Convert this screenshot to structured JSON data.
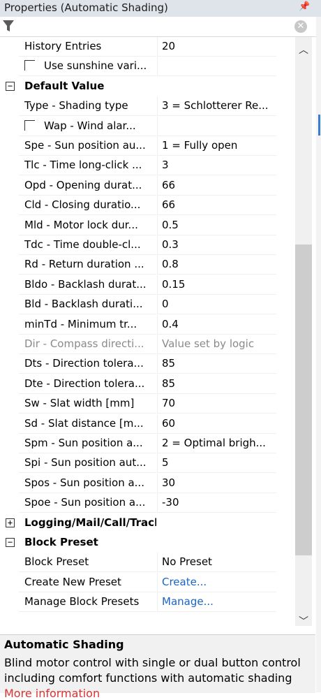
{
  "panel": {
    "title": "Properties (Automatic Shading)",
    "pin_icon": "pin-icon",
    "filter_icon": "filter-icon",
    "clear_icon": "clear-filter-icon",
    "clear_glyph": "✕"
  },
  "rows": [
    {
      "kind": "prop",
      "name": "History Entries",
      "value": "20"
    },
    {
      "kind": "check",
      "name": "Use sunshine vari...",
      "value": ""
    },
    {
      "kind": "cat",
      "name": "Default Value",
      "expander": "⊟",
      "expanded": true
    },
    {
      "kind": "prop",
      "name": "Type - Shading type",
      "value": "3 = Schlotterer Re..."
    },
    {
      "kind": "check",
      "name": "Wap - Wind alar...",
      "value": ""
    },
    {
      "kind": "prop",
      "name": "Spe - Sun position au...",
      "value": "1 = Fully open"
    },
    {
      "kind": "prop",
      "name": "Tlc - Time long-click ...",
      "value": "3"
    },
    {
      "kind": "prop",
      "name": "Opd - Opening durat...",
      "value": "66"
    },
    {
      "kind": "prop",
      "name": "Cld - Closing duratio...",
      "value": "66"
    },
    {
      "kind": "prop",
      "name": "Mld - Motor lock dur...",
      "value": "0.5"
    },
    {
      "kind": "prop",
      "name": "Tdc - Time double-cl...",
      "value": "0.3"
    },
    {
      "kind": "prop",
      "name": "Rd - Return duration ...",
      "value": "0.8"
    },
    {
      "kind": "prop",
      "name": "Bldo - Backlash durat...",
      "value": "0.15"
    },
    {
      "kind": "prop",
      "name": "Bld - Backlash durati...",
      "value": "0"
    },
    {
      "kind": "prop",
      "name": "minTd - Minimum tr...",
      "value": "0.4"
    },
    {
      "kind": "disabled",
      "name": "Dir - Compass directi...",
      "value": "Value set by logic"
    },
    {
      "kind": "prop",
      "name": "Dts - Direction tolera...",
      "value": "85"
    },
    {
      "kind": "prop",
      "name": "Dte - Direction tolera...",
      "value": "85"
    },
    {
      "kind": "prop",
      "name": "Sw - Slat width [mm]",
      "value": "70"
    },
    {
      "kind": "prop",
      "name": "Sd - Slat distance [m...",
      "value": "60"
    },
    {
      "kind": "prop",
      "name": "Spm - Sun position a...",
      "value": "2 = Optimal brigh..."
    },
    {
      "kind": "prop",
      "name": "Spi - Sun position aut...",
      "value": "5"
    },
    {
      "kind": "prop",
      "name": "Spos - Sun position a...",
      "value": "30"
    },
    {
      "kind": "prop",
      "name": "Spoe - Sun position a...",
      "value": "-30"
    },
    {
      "kind": "cat",
      "name": "Logging/Mail/Call/Track",
      "expander": "⊞",
      "expanded": false
    },
    {
      "kind": "cat",
      "name": "Block Preset",
      "expander": "⊟",
      "expanded": true
    },
    {
      "kind": "prop",
      "name": "Block Preset",
      "value": "No Preset"
    },
    {
      "kind": "link",
      "name": "Create New Preset",
      "value": "Create..."
    },
    {
      "kind": "link",
      "name": "Manage Block Presets",
      "value": "Manage..."
    }
  ],
  "description": {
    "title": "Automatic Shading",
    "text": "Blind motor control with single or dual button control including comfort functions with automatic shading",
    "link": "More information"
  },
  "scroll": {
    "position": 0.42,
    "visible_fraction": 0.53
  }
}
